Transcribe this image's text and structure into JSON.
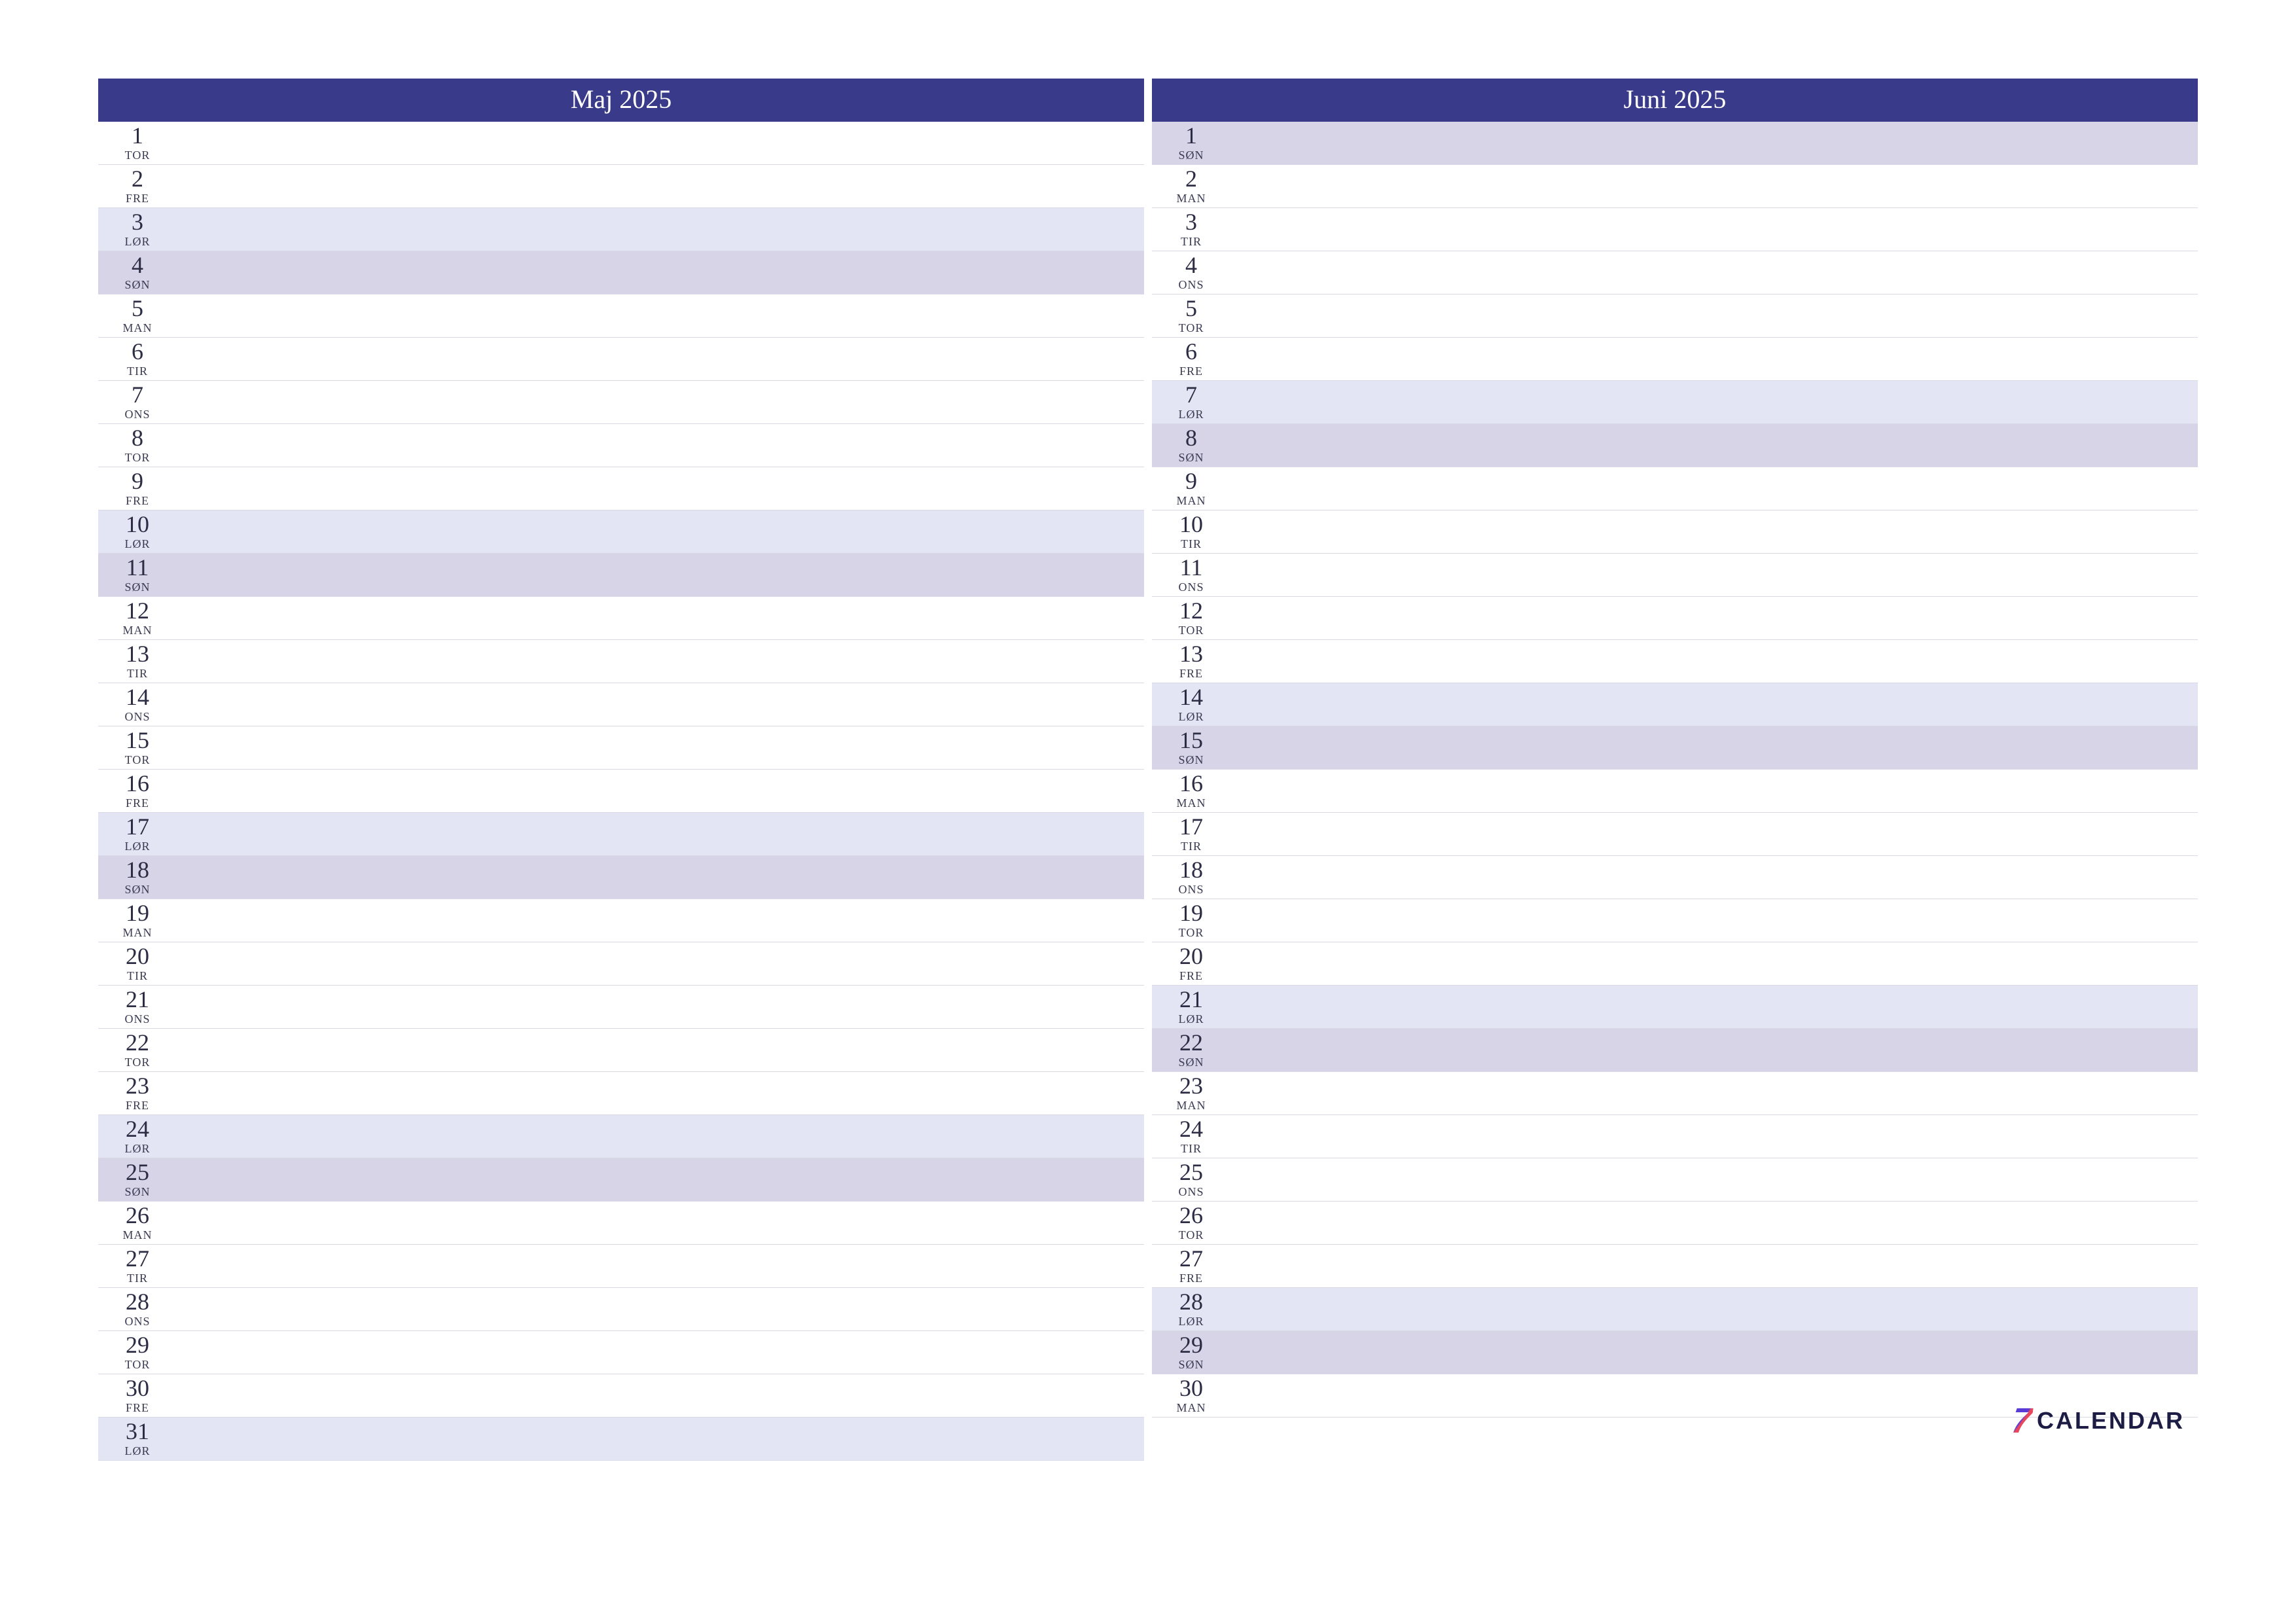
{
  "colors": {
    "header_bg": "#3a3a8a",
    "sat_bg": "#e4e5f4",
    "sun_bg": "#d7d4e8"
  },
  "footer": {
    "seven": "7",
    "word": "CALENDAR"
  },
  "months": [
    {
      "title": "Maj 2025",
      "days": [
        {
          "n": "1",
          "d": "TOR",
          "t": "wd"
        },
        {
          "n": "2",
          "d": "FRE",
          "t": "wd"
        },
        {
          "n": "3",
          "d": "LØR",
          "t": "sat"
        },
        {
          "n": "4",
          "d": "SØN",
          "t": "sun"
        },
        {
          "n": "5",
          "d": "MAN",
          "t": "wd"
        },
        {
          "n": "6",
          "d": "TIR",
          "t": "wd"
        },
        {
          "n": "7",
          "d": "ONS",
          "t": "wd"
        },
        {
          "n": "8",
          "d": "TOR",
          "t": "wd"
        },
        {
          "n": "9",
          "d": "FRE",
          "t": "wd"
        },
        {
          "n": "10",
          "d": "LØR",
          "t": "sat"
        },
        {
          "n": "11",
          "d": "SØN",
          "t": "sun"
        },
        {
          "n": "12",
          "d": "MAN",
          "t": "wd"
        },
        {
          "n": "13",
          "d": "TIR",
          "t": "wd"
        },
        {
          "n": "14",
          "d": "ONS",
          "t": "wd"
        },
        {
          "n": "15",
          "d": "TOR",
          "t": "wd"
        },
        {
          "n": "16",
          "d": "FRE",
          "t": "wd"
        },
        {
          "n": "17",
          "d": "LØR",
          "t": "sat"
        },
        {
          "n": "18",
          "d": "SØN",
          "t": "sun"
        },
        {
          "n": "19",
          "d": "MAN",
          "t": "wd"
        },
        {
          "n": "20",
          "d": "TIR",
          "t": "wd"
        },
        {
          "n": "21",
          "d": "ONS",
          "t": "wd"
        },
        {
          "n": "22",
          "d": "TOR",
          "t": "wd"
        },
        {
          "n": "23",
          "d": "FRE",
          "t": "wd"
        },
        {
          "n": "24",
          "d": "LØR",
          "t": "sat"
        },
        {
          "n": "25",
          "d": "SØN",
          "t": "sun"
        },
        {
          "n": "26",
          "d": "MAN",
          "t": "wd"
        },
        {
          "n": "27",
          "d": "TIR",
          "t": "wd"
        },
        {
          "n": "28",
          "d": "ONS",
          "t": "wd"
        },
        {
          "n": "29",
          "d": "TOR",
          "t": "wd"
        },
        {
          "n": "30",
          "d": "FRE",
          "t": "wd"
        },
        {
          "n": "31",
          "d": "LØR",
          "t": "sat"
        }
      ]
    },
    {
      "title": "Juni 2025",
      "days": [
        {
          "n": "1",
          "d": "SØN",
          "t": "sun"
        },
        {
          "n": "2",
          "d": "MAN",
          "t": "wd"
        },
        {
          "n": "3",
          "d": "TIR",
          "t": "wd"
        },
        {
          "n": "4",
          "d": "ONS",
          "t": "wd"
        },
        {
          "n": "5",
          "d": "TOR",
          "t": "wd"
        },
        {
          "n": "6",
          "d": "FRE",
          "t": "wd"
        },
        {
          "n": "7",
          "d": "LØR",
          "t": "sat"
        },
        {
          "n": "8",
          "d": "SØN",
          "t": "sun"
        },
        {
          "n": "9",
          "d": "MAN",
          "t": "wd"
        },
        {
          "n": "10",
          "d": "TIR",
          "t": "wd"
        },
        {
          "n": "11",
          "d": "ONS",
          "t": "wd"
        },
        {
          "n": "12",
          "d": "TOR",
          "t": "wd"
        },
        {
          "n": "13",
          "d": "FRE",
          "t": "wd"
        },
        {
          "n": "14",
          "d": "LØR",
          "t": "sat"
        },
        {
          "n": "15",
          "d": "SØN",
          "t": "sun"
        },
        {
          "n": "16",
          "d": "MAN",
          "t": "wd"
        },
        {
          "n": "17",
          "d": "TIR",
          "t": "wd"
        },
        {
          "n": "18",
          "d": "ONS",
          "t": "wd"
        },
        {
          "n": "19",
          "d": "TOR",
          "t": "wd"
        },
        {
          "n": "20",
          "d": "FRE",
          "t": "wd"
        },
        {
          "n": "21",
          "d": "LØR",
          "t": "sat"
        },
        {
          "n": "22",
          "d": "SØN",
          "t": "sun"
        },
        {
          "n": "23",
          "d": "MAN",
          "t": "wd"
        },
        {
          "n": "24",
          "d": "TIR",
          "t": "wd"
        },
        {
          "n": "25",
          "d": "ONS",
          "t": "wd"
        },
        {
          "n": "26",
          "d": "TOR",
          "t": "wd"
        },
        {
          "n": "27",
          "d": "FRE",
          "t": "wd"
        },
        {
          "n": "28",
          "d": "LØR",
          "t": "sat"
        },
        {
          "n": "29",
          "d": "SØN",
          "t": "sun"
        },
        {
          "n": "30",
          "d": "MAN",
          "t": "wd"
        }
      ]
    }
  ]
}
